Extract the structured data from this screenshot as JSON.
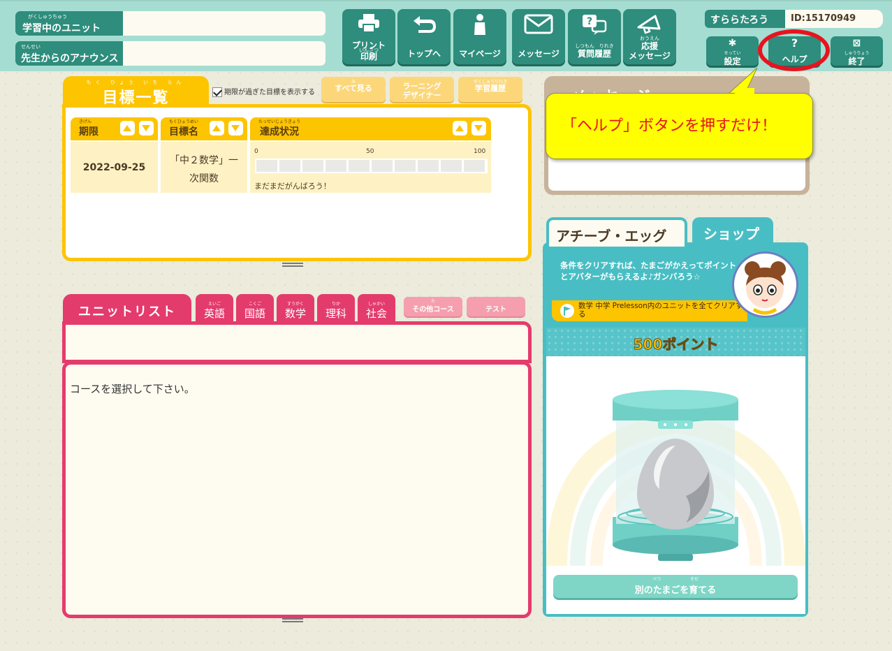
{
  "header": {
    "unit_label": "学習中のユニット",
    "unit_ruby": "がくしゅうちゅう",
    "announce_label": "先生からのアナウンス",
    "announce_ruby": "せんせい",
    "unit_value": "",
    "announce_value": ""
  },
  "nav": {
    "print_label1": "プリント",
    "print_ruby": "いんさつ",
    "print_label2": "印刷",
    "top_label": "トップへ",
    "mypage_label": "マイページ",
    "message_label": "メッセージ",
    "qhistory_ruby": "しつもん　りれき",
    "qhistory_label": "質問履歴",
    "cheer_ruby": "おうえん",
    "cheer_label1": "応援",
    "cheer_label2": "メッセージ"
  },
  "user": {
    "name": "すららたろう",
    "id": "ID:15170949"
  },
  "tools": {
    "settings_ruby": "せってい",
    "settings_label": "設定",
    "help_icon": "?",
    "help_label": "ヘルプ",
    "exit_ruby": "しゅうりょう",
    "exit_label": "終了"
  },
  "goals": {
    "title": "目標一覧",
    "title_ruby": "もく ひょう いち らん",
    "show_expired_label": "期限が過ぎた目標を表示する",
    "show_expired_checked": true,
    "view_all_label": "すべて見る",
    "view_all_ruby": "み",
    "designer_label1": "ラーニング",
    "designer_label2": "デザイナー",
    "history_ruby": "がくしゅうりれき",
    "history_label": "学習履歴",
    "columns": [
      {
        "label": "期限",
        "ruby": "きげん"
      },
      {
        "label": "目標名",
        "ruby": "もくひょうめい"
      },
      {
        "label": "達成状況",
        "ruby": "たっせいじょうきょう"
      }
    ],
    "rows": [
      {
        "deadline": "2022-09-25",
        "name_line1": "「中２数学」一",
        "name_line2": "次関数",
        "progress_min": "0",
        "progress_mid": "50",
        "progress_max": "100",
        "progress_value": 0,
        "status_text": "まだまだがんばろう！"
      }
    ]
  },
  "units": {
    "title": "ユニットリスト",
    "subjects": [
      {
        "label": "英語",
        "ruby": "えいご"
      },
      {
        "label": "国語",
        "ruby": "こくご"
      },
      {
        "label": "数学",
        "ruby": "すうがく"
      },
      {
        "label": "理科",
        "ruby": "りか"
      },
      {
        "label": "社会",
        "ruby": "しゃかい"
      }
    ],
    "other_course_ruby": "た",
    "other_course_label": "その他コース",
    "test_label": "テスト",
    "empty_message": "コースを選択して下さい。"
  },
  "messages": {
    "title": "メッセージ"
  },
  "callout": {
    "text": "「ヘルプ」ボタンを押すだけ！"
  },
  "achieve": {
    "tab_egg": "アチーブ・エッグ",
    "tab_shop": "ショップ",
    "description": "条件をクリアすれば、たまごがかえってポイントとアバターがもらえるよ♪ガンバろう☆",
    "condition": "数学 中学 Prelesson内のユニットを全てクリアする",
    "points": "500ポイント",
    "grow_button_ruby": "べつ　　　　　　　そだ",
    "grow_button": "別のたまごを育てる"
  },
  "colors": {
    "header_bg": "#a6ddd2",
    "teal_dark": "#2e8d7c",
    "goal_yellow": "#fdc400",
    "unit_pink": "#e43b6d",
    "achieve_teal": "#48bec4",
    "callout_yellow": "#ffff00",
    "highlight_red": "#e8131f"
  }
}
